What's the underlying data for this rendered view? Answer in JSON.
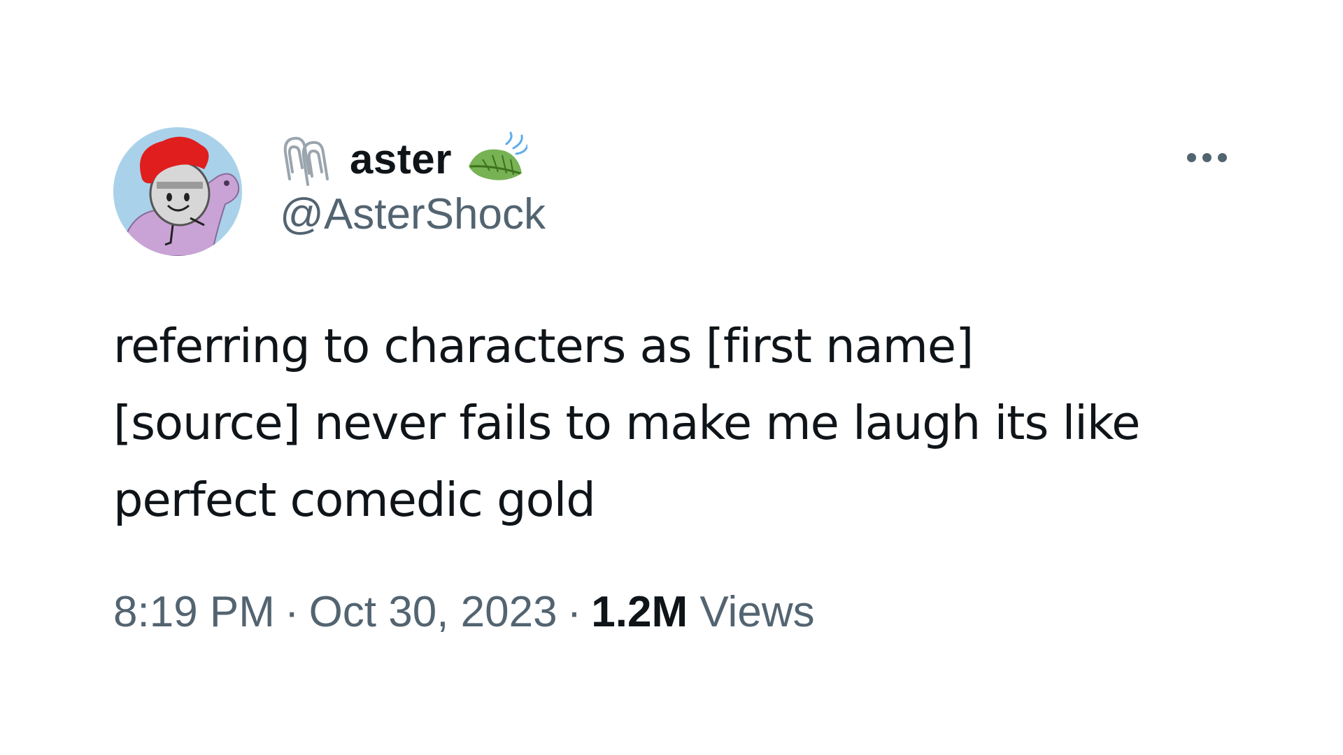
{
  "tweet": {
    "author": {
      "display_name": "aster",
      "handle": "@AsterShock",
      "avatar_icon": "knight-on-horse-avatar",
      "name_prefix_icon": "paperclip-icon",
      "name_suffix_icon": "leaf-fluttering-in-wind-icon"
    },
    "more_icon": "more-horizontal-icon",
    "text_lines": [
      "referring to characters as [first name]",
      "[source] never fails to make me laugh its like",
      "perfect comedic gold"
    ],
    "meta": {
      "time": "8:19 PM",
      "separator": "·",
      "date": "Oct 30, 2023",
      "views_count": "1.2M",
      "views_label": "Views"
    }
  },
  "colors": {
    "primary_text": "#0f1419",
    "secondary_text": "#536471",
    "leaf_green": "#77b255",
    "avatar_bg": "#a9d2ea"
  }
}
